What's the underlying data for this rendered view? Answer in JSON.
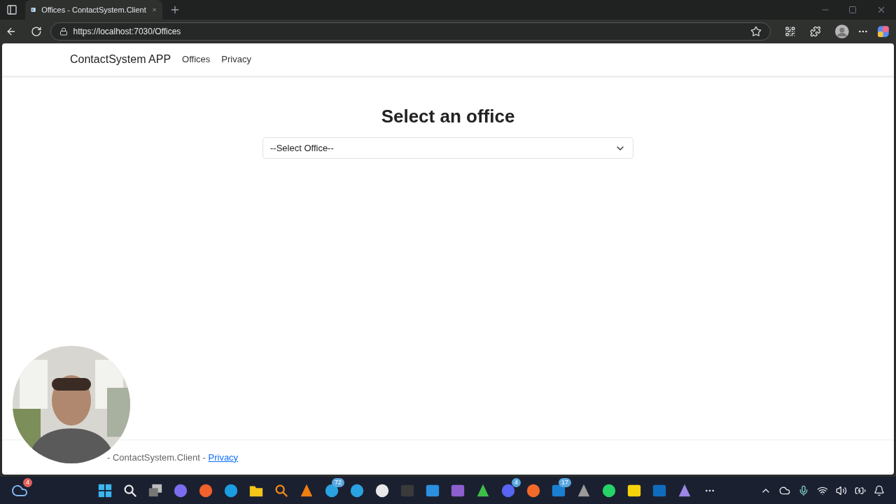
{
  "browser": {
    "tab": {
      "title": "Offices - ContactSystem.Client",
      "selected": true
    },
    "address": "https://localhost:7030/Offices"
  },
  "navbar": {
    "brand": "ContactSystem APP",
    "links": [
      "Offices",
      "Privacy"
    ]
  },
  "main": {
    "heading": "Select an office",
    "select": {
      "value": "--Select Office--"
    }
  },
  "footer": {
    "text": "- ContactSystem.Client - ",
    "link": "Privacy"
  },
  "taskbar": {
    "weather_badge": "4",
    "apps": [
      {
        "kind": "start",
        "color": "#3bb6f0"
      },
      {
        "kind": "search",
        "color": "#e6e6e6"
      },
      {
        "kind": "windows",
        "color": "#bdbdbd"
      },
      {
        "kind": "round",
        "color": "#7b6cf0"
      },
      {
        "kind": "round",
        "color": "#f0612c"
      },
      {
        "kind": "round",
        "color": "#1b9de2"
      },
      {
        "kind": "folder",
        "color": "#f5c518"
      },
      {
        "kind": "search",
        "color": "#f08a1a"
      },
      {
        "kind": "cone",
        "color": "#f07f10"
      },
      {
        "kind": "round",
        "color": "#2aa3e0",
        "badge": "72"
      },
      {
        "kind": "round",
        "color": "#2aa3e0"
      },
      {
        "kind": "round",
        "color": "#e8e8e8"
      },
      {
        "kind": "square",
        "color": "#3a3a3a"
      },
      {
        "kind": "square",
        "color": "#2c8fe0"
      },
      {
        "kind": "square",
        "color": "#8e5fd0"
      },
      {
        "kind": "cone",
        "color": "#3cc04a"
      },
      {
        "kind": "round",
        "color": "#5865f2",
        "badge": "4"
      },
      {
        "kind": "round",
        "color": "#f26a2a"
      },
      {
        "kind": "square",
        "color": "#1a7fd0",
        "badge": "17"
      },
      {
        "kind": "cone",
        "color": "#9a9a9a"
      },
      {
        "kind": "round",
        "color": "#25d366"
      },
      {
        "kind": "square",
        "color": "#f5d20a"
      },
      {
        "kind": "square",
        "color": "#0f6cbd"
      },
      {
        "kind": "cone",
        "color": "#9b87e6"
      }
    ]
  }
}
